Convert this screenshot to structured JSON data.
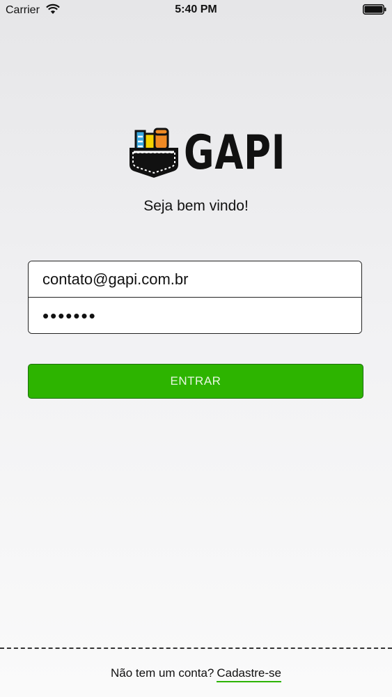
{
  "status_bar": {
    "carrier": "Carrier",
    "time": "5:40 PM"
  },
  "logo": {
    "text": "GAPI"
  },
  "welcome": "Seja bem vindo!",
  "form": {
    "email_value": "contato@gapi.com.br",
    "password_value": "1234567",
    "submit_label": "ENTRAR"
  },
  "footer": {
    "prompt": "Não tem um conta?",
    "signup_label": "Cadastre-se"
  },
  "colors": {
    "accent": "#2db400",
    "logo_blue": "#3aa9e0",
    "logo_yellow": "#f5d200",
    "logo_orange": "#f08a24"
  }
}
